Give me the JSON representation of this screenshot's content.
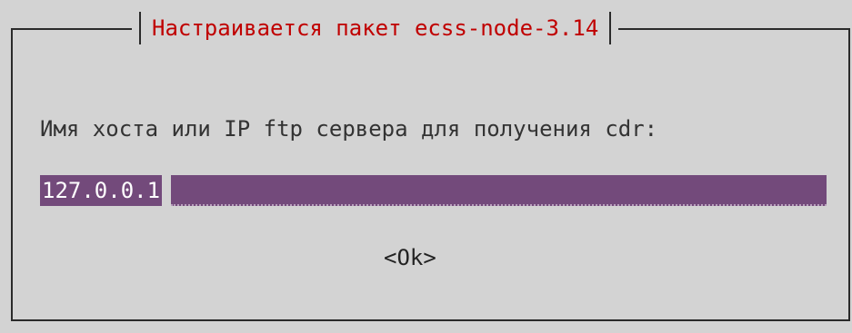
{
  "dialog": {
    "title": "Настраивается пакет ecss-node-3.14",
    "prompt": "Имя хоста или IP ftp сервера для получения cdr:",
    "input_value": "127.0.0.1",
    "ok_label": "<Ok>"
  },
  "colors": {
    "background": "#d3d3d3",
    "title": "#c00000",
    "input_bg": "#734a7b",
    "input_text": "#ffffff",
    "text": "#333333"
  }
}
